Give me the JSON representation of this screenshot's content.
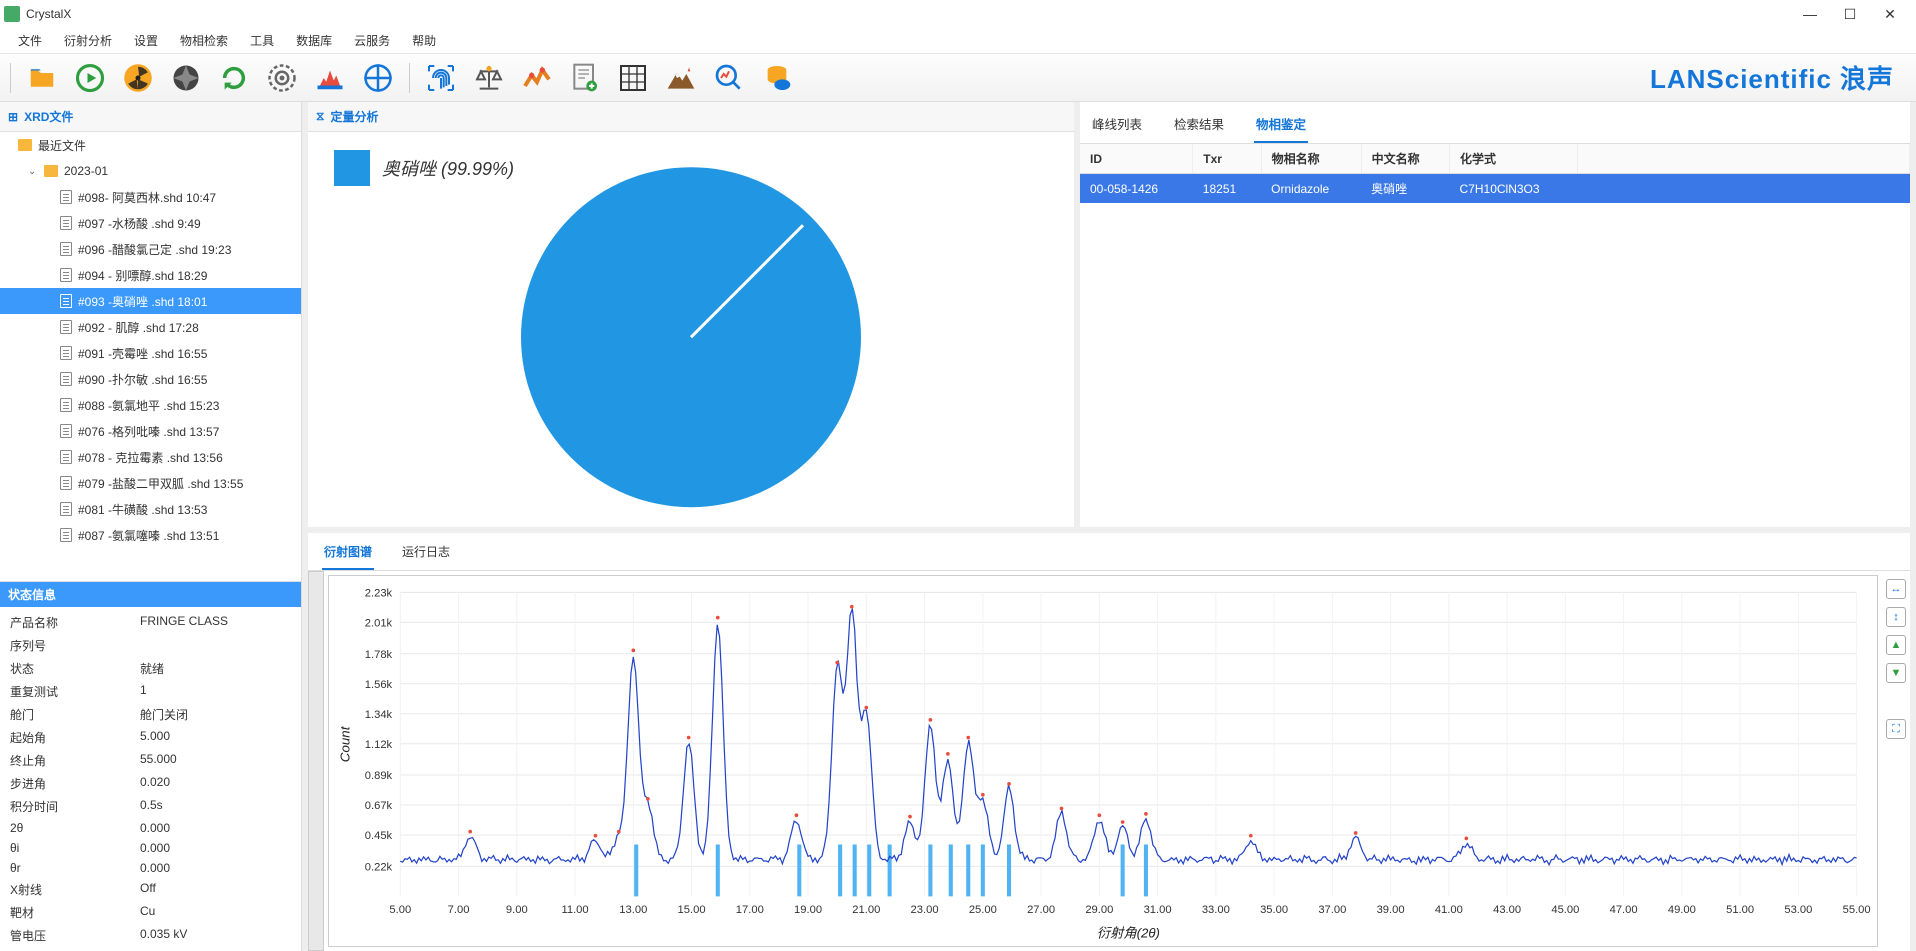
{
  "app": {
    "title": "CrystalX"
  },
  "menu": [
    "文件",
    "衍射分析",
    "设置",
    "物相检索",
    "工具",
    "数据库",
    "云服务",
    "帮助"
  ],
  "brand": {
    "en": "LANScientific",
    "cn": "浪声"
  },
  "left_panel": {
    "title": "XRD文件"
  },
  "tree": {
    "recent": "最近文件",
    "folder": "2023-01",
    "files": [
      "#098- 阿莫西林.shd 10:47",
      "#097 -水杨酸 .shd 9:49",
      "#096 -醋酸氯己定 .shd 19:23",
      "#094 - 别嘌醇.shd 18:29",
      "#093 -奥硝唑 .shd 18:01",
      "#092 - 肌醇 .shd 17:28",
      "#091 -壳霉唑 .shd 16:55",
      "#090 -扑尔敏 .shd 16:55",
      "#088 -氨氯地平 .shd 15:23",
      "#076 -格列吡嗪 .shd 13:57",
      "#078 - 克拉霉素 .shd 13:56",
      "#079 -盐酸二甲双胍 .shd 13:55",
      "#081 -牛磺酸 .shd 13:53",
      "#087 -氨氯噻嗪 .shd 13:51"
    ],
    "selected_index": 4
  },
  "status": {
    "title": "状态信息",
    "rows": [
      {
        "k": "产品名称",
        "v": "FRINGE CLASS"
      },
      {
        "k": "序列号",
        "v": ""
      },
      {
        "k": "状态",
        "v": "就绪"
      },
      {
        "k": "重复测试",
        "v": "1"
      },
      {
        "k": "舱门",
        "v": "舱门关闭"
      },
      {
        "k": "起始角",
        "v": "5.000"
      },
      {
        "k": "终止角",
        "v": "55.000"
      },
      {
        "k": "步进角",
        "v": "0.020"
      },
      {
        "k": "积分时间",
        "v": "0.5s"
      },
      {
        "k": "2θ",
        "v": "0.000"
      },
      {
        "k": "θi",
        "v": "0.000"
      },
      {
        "k": "θr",
        "v": "0.000"
      },
      {
        "k": "X射线",
        "v": "Off"
      },
      {
        "k": "靶材",
        "v": "Cu"
      },
      {
        "k": "管电压",
        "v": "0.035 kV"
      }
    ]
  },
  "pie_panel": {
    "title": "定量分析",
    "legend": "奥硝唑 (99.99%)"
  },
  "table_panel": {
    "tabs": [
      "峰线列表",
      "检索结果",
      "物相鉴定"
    ],
    "active_tab": 2,
    "headers": [
      "ID",
      "Txr",
      "物相名称",
      "中文名称",
      "化学式"
    ],
    "row": {
      "id": "00-058-1426",
      "txr": "18251",
      "name": "Ornidazole",
      "cn": "奥硝唑",
      "formula": "C7H10ClN3O3"
    }
  },
  "chart_tabs": {
    "tabs": [
      "衍射图谱",
      "运行日志"
    ],
    "active": 0
  },
  "chart_data": {
    "type": "line",
    "title": "",
    "xlabel": "衍射角(2θ)",
    "ylabel": "Count",
    "xlim": [
      5,
      55
    ],
    "ylim": [
      0,
      2230
    ],
    "xticks": [
      5,
      7,
      9,
      11,
      13,
      15,
      17,
      19,
      21,
      23,
      25,
      27,
      29,
      31,
      33,
      35,
      37,
      39,
      41,
      43,
      45,
      47,
      49,
      51,
      53,
      55
    ],
    "yticks": [
      220,
      450,
      670,
      890,
      1120,
      1340,
      1560,
      1780,
      2010,
      2230
    ],
    "ytick_labels": [
      "0.22k",
      "0.45k",
      "0.67k",
      "0.89k",
      "1.12k",
      "1.34k",
      "1.56k",
      "1.78k",
      "2.01k",
      "2.23k"
    ],
    "peaks_x": [
      7.4,
      11.7,
      12.5,
      13.0,
      13.5,
      14.9,
      15.9,
      18.6,
      20.0,
      20.5,
      21.0,
      22.5,
      23.2,
      23.8,
      24.5,
      25.0,
      25.9,
      27.7,
      29.0,
      29.8,
      30.6,
      34.2,
      37.8,
      41.6
    ],
    "peaks_y": [
      430,
      400,
      430,
      1760,
      670,
      1120,
      2000,
      550,
      1670,
      2080,
      1340,
      540,
      1250,
      1000,
      1120,
      700,
      780,
      600,
      550,
      500,
      560,
      400,
      420,
      380
    ],
    "baseline": 260,
    "impulses_x": [
      13.1,
      15.9,
      18.7,
      20.1,
      20.6,
      21.1,
      21.8,
      23.2,
      23.9,
      24.5,
      25.0,
      25.9,
      29.8,
      30.6
    ]
  }
}
